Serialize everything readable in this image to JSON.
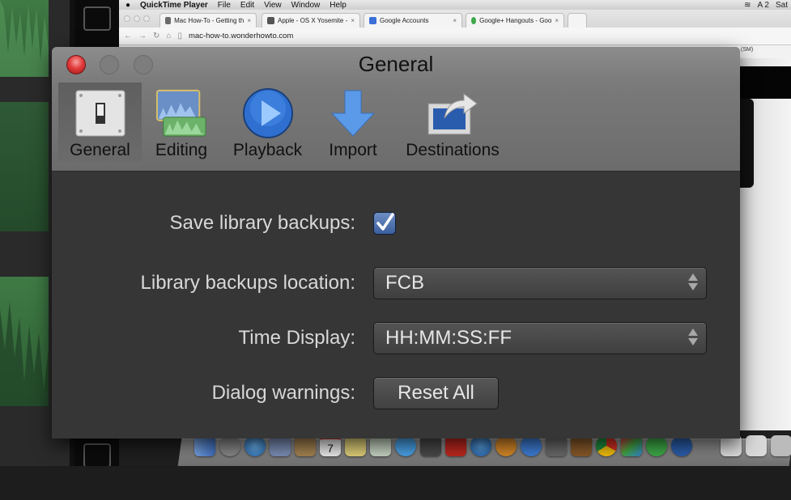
{
  "menubar": {
    "app_name": "QuickTime Player",
    "items": [
      "File",
      "Edit",
      "View",
      "Window",
      "Help"
    ],
    "status": [
      "A 2",
      "Sat"
    ]
  },
  "browser": {
    "tabs": [
      {
        "label": "Mac How-To - Getting th",
        "favicon_color": "#6b6b6b"
      },
      {
        "label": "Apple - OS X Yosemite - ",
        "favicon_color": "#555555"
      },
      {
        "label": "Google Accounts",
        "favicon_color": "#3b6fd8"
      },
      {
        "label": "Google+ Hangouts - Goo",
        "favicon_color": "#3da84a"
      }
    ],
    "url": "mac-how-to.wonderhowto.com",
    "side_label": "(SM)"
  },
  "prefs": {
    "title": "General",
    "toolbar": [
      {
        "id": "general",
        "label": "General",
        "icon": "switch-icon",
        "active": true
      },
      {
        "id": "editing",
        "label": "Editing",
        "icon": "waveform-edit-icon",
        "active": false
      },
      {
        "id": "playback",
        "label": "Playback",
        "icon": "play-icon",
        "active": false
      },
      {
        "id": "import",
        "label": "Import",
        "icon": "download-arrow-icon",
        "active": false
      },
      {
        "id": "destinations",
        "label": "Destinations",
        "icon": "share-icon",
        "active": false
      }
    ],
    "fields": {
      "save_backups": {
        "label": "Save library backups:",
        "checked": true
      },
      "backup_location": {
        "label": "Library backups location:",
        "value": "FCB"
      },
      "time_display": {
        "label": "Time Display:",
        "value": "HH:MM:SS:FF"
      },
      "dialog_warnings": {
        "label": "Dialog warnings:",
        "button": "Reset All"
      }
    }
  },
  "dock": {
    "apps": [
      "Finder",
      "Launchpad",
      "Safari",
      "Mail",
      "Contacts",
      "Calendar",
      "Notes",
      "Preview",
      "Messages",
      "FaceTime",
      "Photo Booth",
      "iTunes",
      "iBooks",
      "App Store",
      "System Preferences",
      "GarageBand",
      "Chrome",
      "Final Cut Pro",
      "WhatsApp",
      "QuickTime",
      "Document",
      "Downloads",
      "Trash"
    ],
    "calendar_day": "7"
  }
}
